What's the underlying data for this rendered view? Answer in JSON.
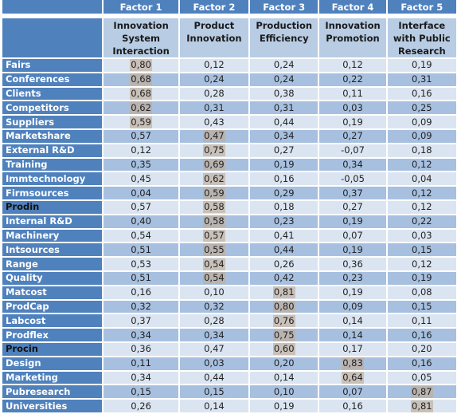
{
  "table": {
    "factor_headers": [
      "Factor 1",
      "Factor 2",
      "Factor 3",
      "Factor 4",
      "Factor 5"
    ],
    "factor_names": [
      [
        "Innovation",
        "System",
        "Interaction"
      ],
      [
        "Product",
        "Innovation"
      ],
      [
        "Production",
        "Efficiency"
      ],
      [
        "Innovation",
        "Promotion"
      ],
      [
        "Interface",
        "with Public",
        "Research"
      ]
    ],
    "rows": [
      {
        "label": "Fairs",
        "values": [
          "0,80",
          "0,12",
          "0,24",
          "0,12",
          "0,19"
        ],
        "highlight": 0
      },
      {
        "label": "Conferences",
        "values": [
          "0,68",
          "0,24",
          "0,24",
          "0,22",
          "0,31"
        ],
        "highlight": 0
      },
      {
        "label": "Clients",
        "values": [
          "0,68",
          "0,28",
          "0,38",
          "0,11",
          "0,16"
        ],
        "highlight": 0
      },
      {
        "label": "Competitors",
        "values": [
          "0,62",
          "0,31",
          "0,31",
          "0,03",
          "0,25"
        ],
        "highlight": 0
      },
      {
        "label": "Suppliers",
        "values": [
          "0,59",
          "0,43",
          "0,44",
          "0,19",
          "0,09"
        ],
        "highlight": 0
      },
      {
        "label": "Marketshare",
        "values": [
          "0,57",
          "0,47",
          "0,34",
          "0,27",
          "0,09"
        ],
        "highlight": 1
      },
      {
        "label": "External R&D",
        "values": [
          "0,12",
          "0,75",
          "0,27",
          "-0,07",
          "0,18"
        ],
        "highlight": 1
      },
      {
        "label": "Training",
        "values": [
          "0,35",
          "0,69",
          "0,19",
          "0,34",
          "0,12"
        ],
        "highlight": 1
      },
      {
        "label": "Immtechnology",
        "values": [
          "0,45",
          "0,62",
          "0,16",
          "-0,05",
          "0,04"
        ],
        "highlight": 1
      },
      {
        "label": "Firmsources",
        "values": [
          "0,04",
          "0,59",
          "0,29",
          "0,37",
          "0,12"
        ],
        "highlight": 1
      },
      {
        "label": "Prodin",
        "values": [
          "0,57",
          "0,58",
          "0,18",
          "0,27",
          "0,12"
        ],
        "highlight": 1,
        "dark_label": true
      },
      {
        "label": "Internal R&D",
        "values": [
          "0,40",
          "0,58",
          "0,23",
          "0,19",
          "0,22"
        ],
        "highlight": 1
      },
      {
        "label": "Machinery",
        "values": [
          "0,54",
          "0,57",
          "0,41",
          "0,07",
          "0,03"
        ],
        "highlight": 1
      },
      {
        "label": "Intsources",
        "values": [
          "0,51",
          "0,55",
          "0,44",
          "0,19",
          "0,15"
        ],
        "highlight": 1
      },
      {
        "label": "Range",
        "values": [
          "0,53",
          "0,54",
          "0,26",
          "0,36",
          "0,12"
        ],
        "highlight": 1
      },
      {
        "label": "Quality",
        "values": [
          "0,51",
          "0,54",
          "0,42",
          "0,23",
          "0,19"
        ],
        "highlight": 1
      },
      {
        "label": "Matcost",
        "values": [
          "0,16",
          "0,10",
          "0,81",
          "0,19",
          "0,08"
        ],
        "highlight": 2
      },
      {
        "label": "ProdCap",
        "values": [
          "0,32",
          "0,32",
          "0,80",
          "0,09",
          "0,15"
        ],
        "highlight": 2
      },
      {
        "label": "Labcost",
        "values": [
          "0,37",
          "0,28",
          "0,76",
          "0,14",
          "0,11"
        ],
        "highlight": 2
      },
      {
        "label": "Prodflex",
        "values": [
          "0,34",
          "0,34",
          "0,75",
          "0,14",
          "0,16"
        ],
        "highlight": 2
      },
      {
        "label": "Procin",
        "values": [
          "0,36",
          "0,47",
          "0,60",
          "0,17",
          "0,20"
        ],
        "highlight": 2,
        "dark_label": true
      },
      {
        "label": "Design",
        "values": [
          "0,11",
          "0,03",
          "0,20",
          "0,83",
          "0,16"
        ],
        "highlight": 3
      },
      {
        "label": "Marketing",
        "values": [
          "0,34",
          "0,44",
          "0,14",
          "0,64",
          "0,05"
        ],
        "highlight": 3
      },
      {
        "label": "Pubresearch",
        "values": [
          "0,15",
          "0,15",
          "0,10",
          "0,07",
          "0,87"
        ],
        "highlight": 4
      },
      {
        "label": "Universities",
        "values": [
          "0,26",
          "0,14",
          "0,19",
          "0,16",
          "0,81"
        ],
        "highlight": 4
      }
    ]
  },
  "colors": {
    "header_blue": "#4f81bd",
    "row_light": "#dbe5f1",
    "row_dark": "#a7c0e0",
    "highlight_gray": "#c9c0b8"
  }
}
